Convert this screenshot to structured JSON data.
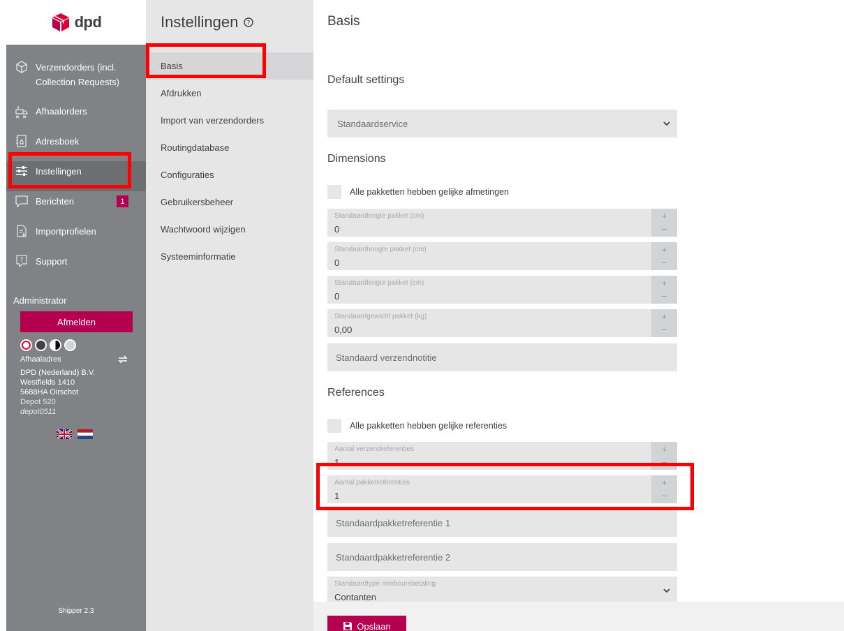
{
  "brand": {
    "logo_text": "dpd",
    "accent": "#b4004e"
  },
  "sidebar": {
    "items": [
      {
        "label_line1": "Verzendorders (incl.",
        "label_line2": "Collection Requests)",
        "icon": "package-icon"
      },
      {
        "label": "Afhaalorders",
        "icon": "pickup-truck-icon"
      },
      {
        "label": "Adresboek",
        "icon": "address-book-icon"
      },
      {
        "label": "Instellingen",
        "icon": "sliders-icon",
        "active": true
      },
      {
        "label": "Berichten",
        "icon": "message-icon",
        "badge": "1"
      },
      {
        "label": "Importprofielen",
        "icon": "import-file-icon"
      },
      {
        "label": "Support",
        "icon": "support-icon"
      }
    ],
    "admin_label": "Administrator",
    "logout_label": "Afmelden",
    "pickup_label": "Afhaaladres",
    "address": {
      "line1": "DPD (Nederland) B.V.",
      "line2": "Westfields 1410",
      "line3": "5688HA Oirschot",
      "line4": "Depot 520",
      "line5": "depot0511"
    },
    "version": "Shipper 2.3"
  },
  "submenu": {
    "title": "Instellingen",
    "items": [
      {
        "label": "Basis",
        "active": true
      },
      {
        "label": "Afdrukken"
      },
      {
        "label": "Import van verzendorders"
      },
      {
        "label": "Routingdatabase"
      },
      {
        "label": "Configuraties"
      },
      {
        "label": "Gebruikersbeheer"
      },
      {
        "label": "Wachtwoord wijzigen"
      },
      {
        "label": "Systeeminformatie"
      }
    ]
  },
  "main": {
    "title": "Basis",
    "default_settings": {
      "heading": "Default settings",
      "service_select": "Standaardservice"
    },
    "dimensions": {
      "heading": "Dimensions",
      "equal_checkbox_label": "Alle pakketten hebben gelijke afmetingen",
      "fields": [
        {
          "placeholder": "Standaardlengte pakket (cm)",
          "value": "0"
        },
        {
          "placeholder": "Standaardhoogte pakket (cm)",
          "value": "0"
        },
        {
          "placeholder": "Standaardlengte pakket (cm)",
          "value": "0"
        },
        {
          "placeholder": "Standaardgewicht pakket (kg)",
          "value": "0,00"
        }
      ],
      "note_placeholder": "Standaard verzendnotitie"
    },
    "references": {
      "heading": "References",
      "equal_checkbox_label": "Alle pakketten hebben gelijke referenties",
      "fields": [
        {
          "placeholder": "Aantal verzendreferenties",
          "value": "1"
        },
        {
          "placeholder": "Aantal pakketreferenties",
          "value": "1"
        }
      ],
      "ref1_placeholder": "Standaardpakketreferentie 1",
      "ref2_placeholder": "Standaardpakketreferentie 2",
      "cod_type": {
        "placeholder": "Standaardtype rembours­betaling",
        "value": "Contanten"
      }
    },
    "save_label": "Opslaan"
  },
  "stepper": {
    "plus": "+",
    "minus": "–"
  }
}
